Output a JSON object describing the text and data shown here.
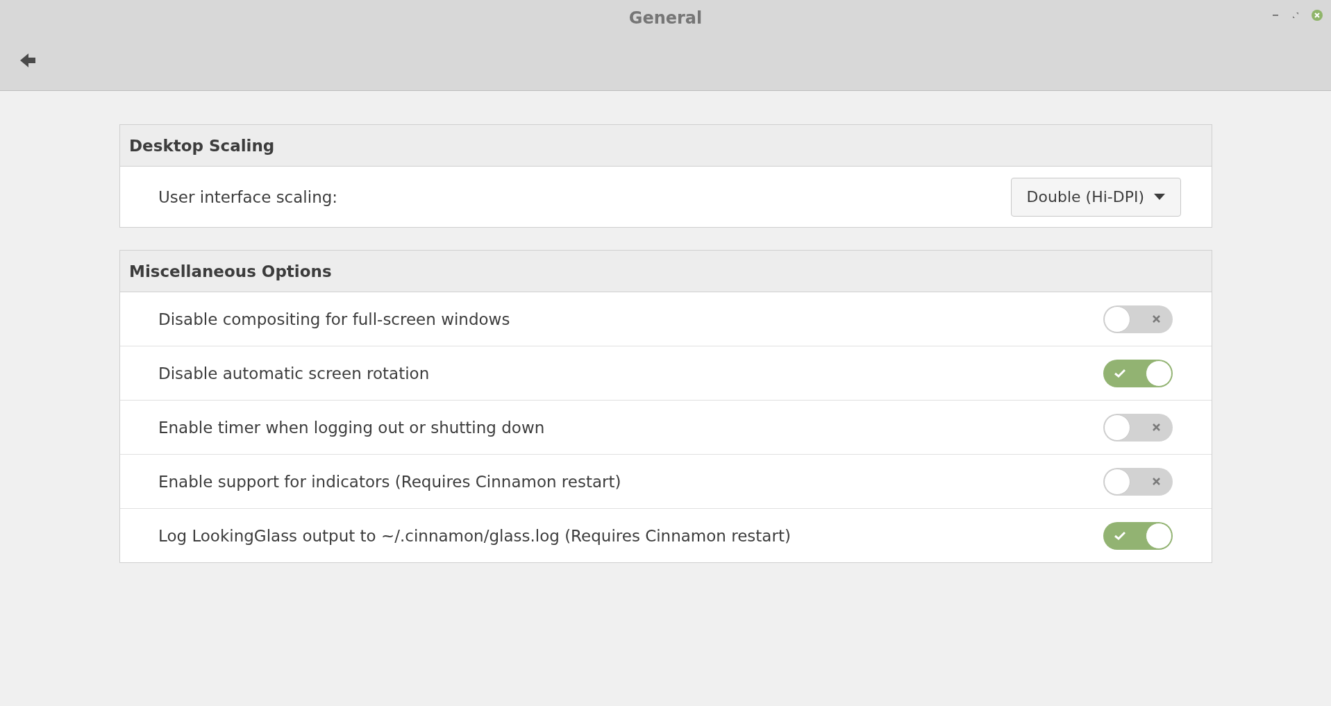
{
  "window": {
    "title": "General"
  },
  "sections": [
    {
      "title": "Desktop Scaling",
      "rows": [
        {
          "kind": "dropdown",
          "label": "User interface scaling:",
          "value": "Double (Hi-DPI)"
        }
      ]
    },
    {
      "title": "Miscellaneous Options",
      "rows": [
        {
          "kind": "switch",
          "label": "Disable compositing for full-screen windows",
          "on": false
        },
        {
          "kind": "switch",
          "label": "Disable automatic screen rotation",
          "on": true
        },
        {
          "kind": "switch",
          "label": "Enable timer when logging out or shutting down",
          "on": false
        },
        {
          "kind": "switch",
          "label": "Enable support for indicators (Requires Cinnamon restart)",
          "on": false
        },
        {
          "kind": "switch",
          "label": "Log LookingGlass output to ~/.cinnamon/glass.log (Requires Cinnamon restart)",
          "on": true
        }
      ]
    }
  ]
}
